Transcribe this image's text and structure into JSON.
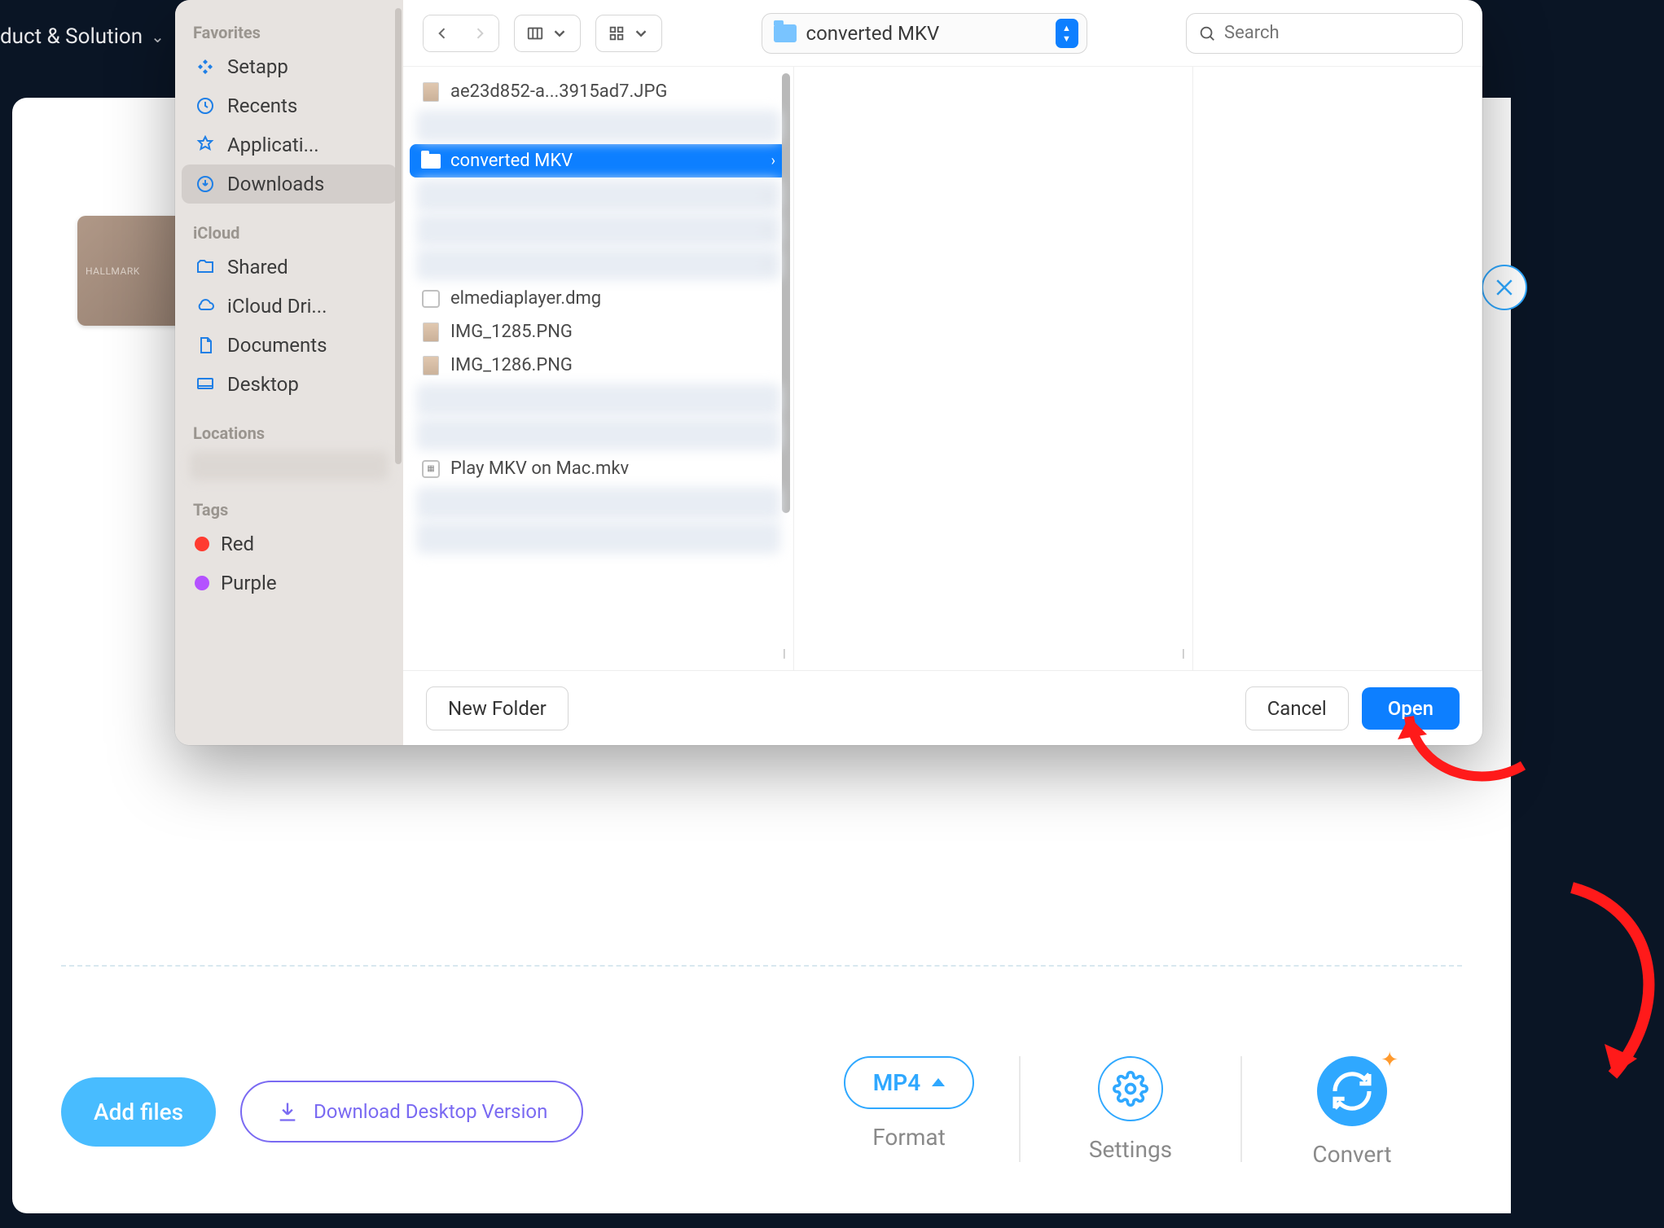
{
  "nav": {
    "label": "duct & Solution"
  },
  "app": {
    "thumb_hint": "HALLMARK",
    "add_files": "Add files",
    "download_desktop": "Download Desktop Version",
    "format": {
      "label": "Format",
      "value": "MP4"
    },
    "settings_label": "Settings",
    "convert_label": "Convert"
  },
  "finder": {
    "sidebar": {
      "favorites_header": "Favorites",
      "favorites": [
        "Setapp",
        "Recents",
        "Applicati...",
        "Downloads"
      ],
      "icloud_header": "iCloud",
      "icloud": [
        "Shared",
        "iCloud Dri...",
        "Documents",
        "Desktop"
      ],
      "locations_header": "Locations",
      "tags_header": "Tags",
      "tags": [
        {
          "label": "Red",
          "color": "#ff3b30"
        },
        {
          "label": "Purple",
          "color": "#b452ff"
        }
      ]
    },
    "path": "converted MKV",
    "search_placeholder": "Search",
    "files": [
      {
        "kind": "img",
        "name": "ae23d852-a...3915ad7.JPG"
      },
      {
        "kind": "blur"
      },
      {
        "kind": "folder",
        "name": "converted MKV",
        "selected": true,
        "chev": true
      },
      {
        "kind": "blur",
        "chev": true
      },
      {
        "kind": "blur",
        "chev": true
      },
      {
        "kind": "blur",
        "chev": true
      },
      {
        "kind": "dmg",
        "name": "elmediaplayer.dmg"
      },
      {
        "kind": "img",
        "name": "IMG_1285.PNG"
      },
      {
        "kind": "img",
        "name": "IMG_1286.PNG"
      },
      {
        "kind": "blur"
      },
      {
        "kind": "blur"
      },
      {
        "kind": "mkv",
        "name": "Play MKV on Mac.mkv"
      },
      {
        "kind": "blur"
      },
      {
        "kind": "blur"
      }
    ],
    "footer": {
      "new_folder": "New Folder",
      "cancel": "Cancel",
      "open": "Open"
    }
  }
}
